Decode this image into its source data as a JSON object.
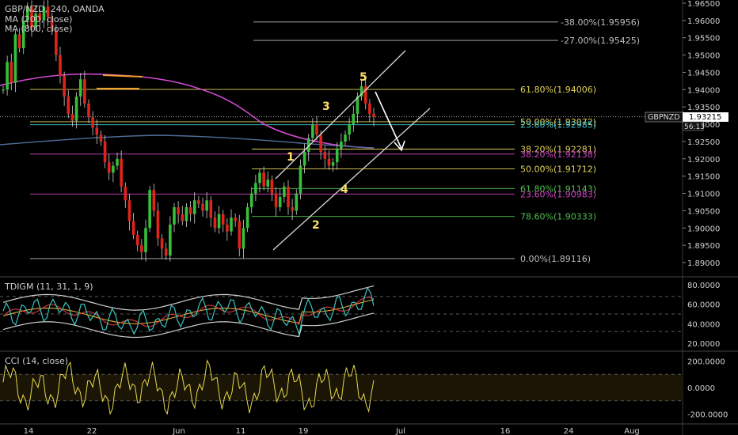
{
  "header": {
    "symbol_line": "GBP/NZD, 240, OANDA",
    "ma1": "MA (200, close)",
    "ma2": "MA (800, close)"
  },
  "price_tag": {
    "symbol": "GBPNZD",
    "price": "1.93215",
    "timer": "56:13"
  },
  "price_axis": [
    "1.96500",
    "1.96000",
    "1.95500",
    "1.95000",
    "1.94500",
    "1.94000",
    "1.93500",
    "1.93000",
    "1.92500",
    "1.92000",
    "1.91500",
    "1.91000",
    "1.90500",
    "1.90000",
    "1.89500",
    "1.89000"
  ],
  "fib_upper": [
    {
      "text": "-38.00%(1.95956)",
      "value": 1.95956,
      "color": "#bdbdbd"
    },
    {
      "text": "-27.00%(1.95425)",
      "value": 1.95425,
      "color": "#bdbdbd"
    },
    {
      "text": "61.80%(1.94006)",
      "value": 1.94006,
      "color": "#e3d25a"
    },
    {
      "text": "50.00%(1.93072)",
      "value": 1.93072,
      "color": "#e3d25a"
    },
    {
      "text": "23.60%(1.92985)",
      "value": 1.92985,
      "color": "#3fc6cf"
    },
    {
      "text": "38.20%(1.92281)",
      "value": 1.92281,
      "color": "#e3d25a"
    },
    {
      "text": "38.20%(1.92138)",
      "value": 1.92138,
      "color": "#d146c6"
    },
    {
      "text": "50.00%(1.91712)",
      "value": 1.91712,
      "color": "#e3d25a"
    },
    {
      "text": "61.80%(1.91143)",
      "value": 1.91143,
      "color": "#4fbf4f"
    },
    {
      "text": "23.60%(1.90983)",
      "value": 1.90983,
      "color": "#d146c6"
    },
    {
      "text": "78.60%(1.90333)",
      "value": 1.90333,
      "color": "#4fbf4f"
    },
    {
      "text": "0.00%(1.89116)",
      "value": 1.89116,
      "color": "#bdbdbd"
    }
  ],
  "waves": [
    "1",
    "2",
    "3",
    "4",
    "5"
  ],
  "tdi": {
    "label": "TDIGM (11, 31, 1, 9)",
    "axis": [
      "80.0000",
      "60.0000",
      "40.0000",
      "20.0000"
    ]
  },
  "cci": {
    "label": "CCI (14, close)",
    "axis": [
      "200.0000",
      "0.0000",
      "-200.0000"
    ]
  },
  "time_axis": [
    "14",
    "22",
    "Jun",
    "11",
    "19",
    "Jul",
    "16",
    "24",
    "Aug"
  ],
  "chart_data": {
    "type": "candlestick",
    "title": "GBP/NZD, 240, OANDA",
    "ylim": [
      1.8885,
      1.9665
    ],
    "series_hint": "GBP/NZD 4h candles with MA 200 and MA 800, Fibonacci levels, Elliott waves 1-5 and ascending channel",
    "ma200_color": "#d24ad0",
    "ma800_color": "#4f6d97",
    "fib_values": [
      1.95956,
      1.95425,
      1.94006,
      1.93072,
      1.92985,
      1.92281,
      1.92138,
      1.91712,
      1.91143,
      1.90983,
      1.90333,
      1.89116
    ],
    "last_price": 1.93215,
    "tdi_ylim": [
      15,
      85
    ],
    "cci_ylim": [
      -250,
      250
    ]
  }
}
